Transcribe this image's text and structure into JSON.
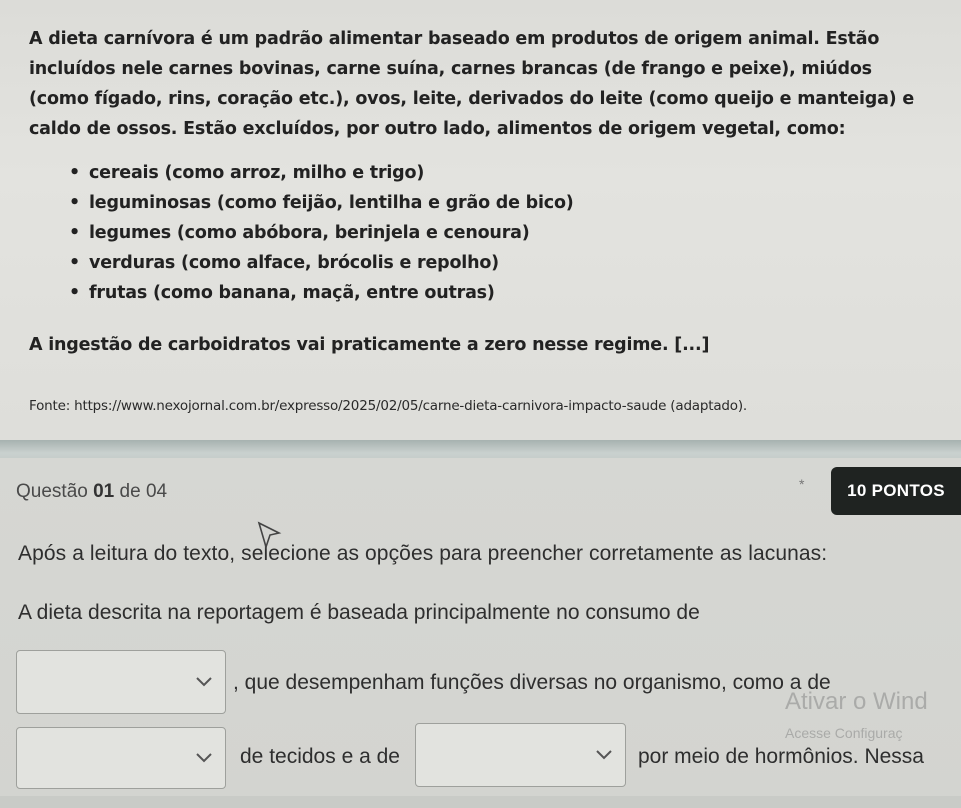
{
  "passage": {
    "paragraph": "A dieta carnívora é um padrão alimentar baseado em produtos de origem animal. Estão incluídos nele carnes bovinas, carne suína, carnes brancas (de frango e peixe), miúdos (como fígado, rins, coração etc.), ovos, leite, derivados do leite (como queijo e manteiga) e caldo de ossos. Estão excluídos, por outro lado, alimentos de origem vegetal, como:",
    "bullets": [
      "cereais (como arroz, milho e trigo)",
      "leguminosas (como feijão, lentilha e grão de bico)",
      "legumes (como abóbora, berinjela e cenoura)",
      "verduras (como alface, brócolis e repolho)",
      "frutas (como banana, maçã, entre outras)"
    ],
    "closing": "A ingestão de carboidratos vai praticamente a zero nesse regime. [...]",
    "source": "Fonte: https://www.nexojornal.com.br/expresso/2025/02/05/carne-dieta-carnivora-impacto-saude (adaptado)."
  },
  "question": {
    "label_prefix": "Questão ",
    "number": "01",
    "label_suffix": " de 04",
    "points": "10 PONTOS",
    "star": "*",
    "instruction": "Após a leitura do texto, selecione as opções para preencher corretamente as lacunas:",
    "statement": "A dieta descrita na reportagem é baseada principalmente no consumo de",
    "after_select1": ", que desempenham funções diversas no organismo, como a de",
    "after_select2": "de tecidos e a de",
    "after_select3": "por meio de hormônios. Nessa"
  },
  "watermark": {
    "line1": "Ativar o Wind",
    "line2": "Acesse Configuraç"
  }
}
